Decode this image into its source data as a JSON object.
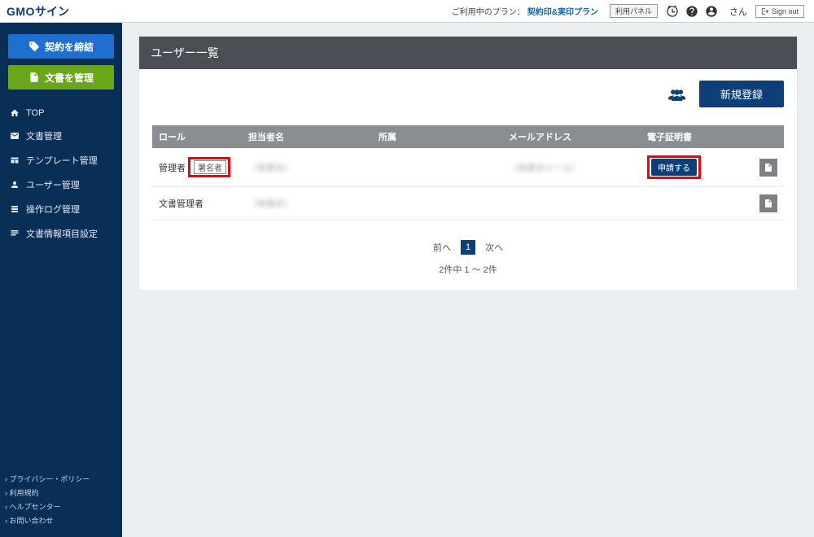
{
  "header": {
    "logo_prefix": "GMO",
    "logo_suffix": "サイン",
    "plan_label": "ご利用中のプラン：",
    "plan_name": "契約印&実印プラン",
    "usage_button": "利用パネル",
    "user_suffix": "さん",
    "signout": "Sign out"
  },
  "sidebar": {
    "sign_button": "契約を締結",
    "manage_button": "文書を管理",
    "items": [
      {
        "label": "TOP"
      },
      {
        "label": "文書管理"
      },
      {
        "label": "テンプレート管理"
      },
      {
        "label": "ユーザー管理"
      },
      {
        "label": "操作ログ管理"
      },
      {
        "label": "文書情報項目設定"
      }
    ],
    "footer": [
      "プライバシー・ポリシー",
      "利用規約",
      "ヘルプセンター",
      "お問い合わせ"
    ]
  },
  "main": {
    "title": "ユーザー一覧",
    "new_button": "新規登録",
    "columns": {
      "role": "ロール",
      "name": "担当者名",
      "dept": "所属",
      "email": "メールアドレス",
      "cert": "電子証明書"
    },
    "rows": [
      {
        "role_main": "管理者",
        "role_tag": "署名者",
        "name": "（非表示）",
        "email": "（非表示メール）",
        "apply": "申請する",
        "tag_hl": true,
        "apply_hl": true
      },
      {
        "role_main": "文書管理者",
        "role_tag": "",
        "name": "（非表示）",
        "email": "",
        "apply": "",
        "tag_hl": false,
        "apply_hl": false
      }
    ],
    "pager": {
      "prev": "前へ",
      "page": "1",
      "next": "次へ",
      "count": "2件中 1 ～ 2件"
    }
  }
}
